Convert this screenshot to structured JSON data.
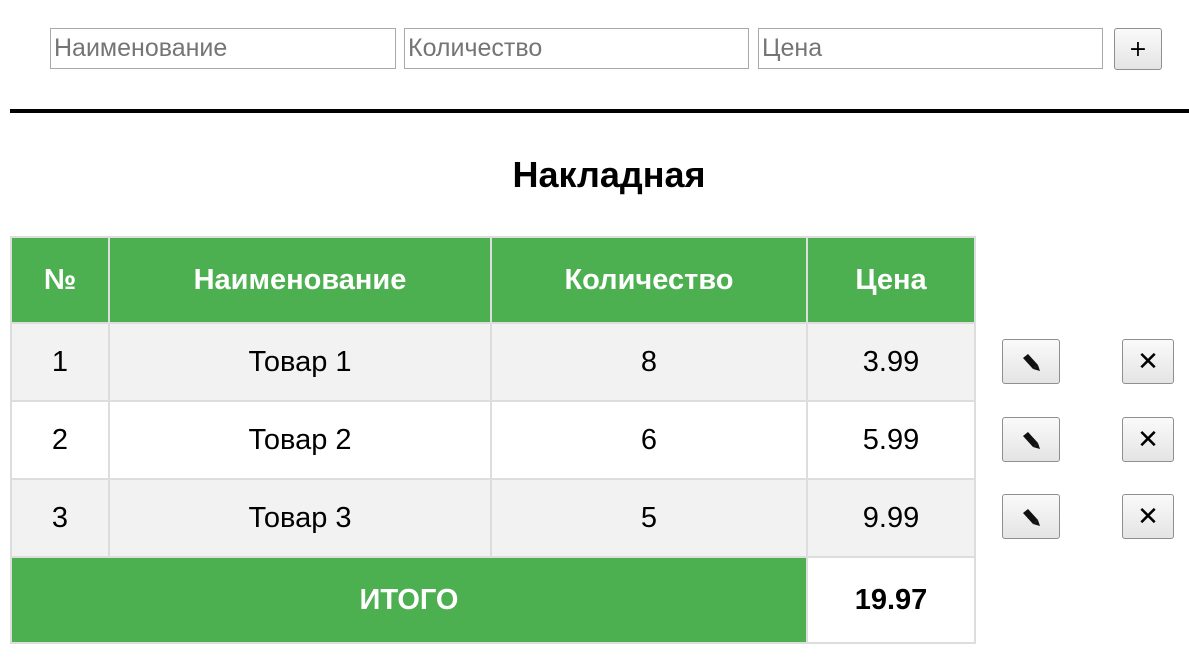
{
  "form": {
    "name_placeholder": "Наименование",
    "qty_placeholder": "Количество",
    "price_placeholder": "Цена",
    "add_label": "+"
  },
  "title": "Накладная",
  "table": {
    "headers": [
      "№",
      "Наименование",
      "Количество",
      "Цена"
    ],
    "rows": [
      {
        "num": "1",
        "name": "Товар 1",
        "qty": "8",
        "price": "3.99"
      },
      {
        "num": "2",
        "name": "Товар 2",
        "qty": "6",
        "price": "5.99"
      },
      {
        "num": "3",
        "name": "Товар 3",
        "qty": "5",
        "price": "9.99"
      }
    ],
    "total_label": "ИТОГО",
    "total_value": "19.97"
  },
  "actions": {
    "edit_icon": "pencil-icon",
    "delete_label": "✕",
    "delete_icon": "close-icon"
  },
  "colors": {
    "accent": "#4caf50",
    "row_alt": "#f2f2f2",
    "border": "#dddddd"
  }
}
